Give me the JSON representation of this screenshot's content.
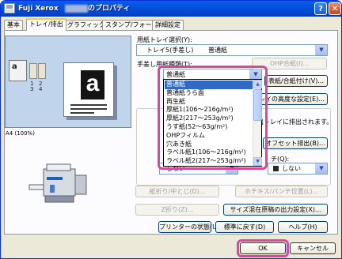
{
  "titlebar": {
    "title_prefix": "Fuji Xerox",
    "title_suffix": "のプロパティ",
    "help_label": "?",
    "close_label": "✕"
  },
  "tabs": [
    "基本",
    "トレイ/排出",
    "グラフィックス",
    "スタンプ/フォーム",
    "詳細設定"
  ],
  "active_tab": "トレイ/排出",
  "preview": {
    "tray_labels": [
      "1",
      "2",
      "3",
      "4"
    ],
    "paper_size": "A4 (100%)"
  },
  "tray_select": {
    "label": "用紙トレイ選択(Y):",
    "value_tray": "トレイ5(手差し)",
    "value_paper": "普通紙"
  },
  "paper_type": {
    "label": "手差し用紙種類(T):",
    "value": "普通紙",
    "options": [
      "普通紙",
      "普通紙うら面",
      "再生紙",
      "厚紙1(106～216g/m²)",
      "厚紙2(217～253g/m²)",
      "うす紙(52～63g/m²)",
      "OHPフィルム",
      "穴あき紙",
      "ラベル紙1(106～216g/m²)",
      "ラベル紙2(217～253g/m²)"
    ]
  },
  "buttons": {
    "ohp_interleave": "OHP合紙(I)...",
    "cover_sheet": "表紙/合紙付け(V)...",
    "tray_priority": "トレイの高度な設定(E)...",
    "output_note": "排出トレイに排出されます。",
    "offset_output": "オフセット排出(B)...",
    "fold_center": "紙折り/中とじ(D)...",
    "staple_punch": "ホチキス/パンチ位置(L)...",
    "z_fold": "Z折り(Z)...",
    "mixed_size": "サイズ混在原稿の出力設定(X)...",
    "printer_status": "プリンターの状態(U)",
    "restore_defaults": "標準に戻す(D)",
    "help": "ヘルプ(H)",
    "ok": "OK",
    "cancel": "キャンセル"
  },
  "lower_combos": {
    "left_value": "しない",
    "right_label": "チ(Q):",
    "right_value": "しない"
  },
  "colors": {
    "titlebar": "#0450e0",
    "selection": "#316ac5",
    "highlight": "#d64a9c",
    "window_bg": "#ece9d8"
  }
}
